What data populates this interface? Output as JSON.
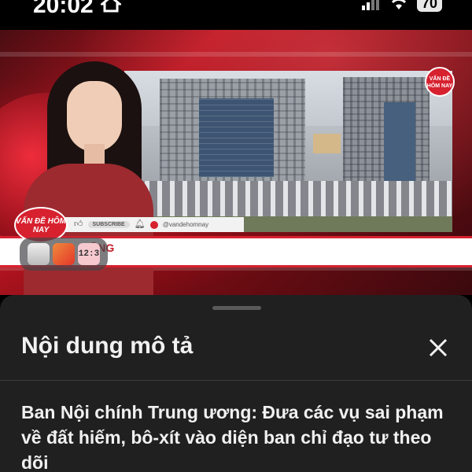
{
  "status_bar": {
    "time": "20:02",
    "battery": "70",
    "icons": [
      "home-icon",
      "cellular-signal-icon",
      "wifi-icon",
      "battery-icon"
    ]
  },
  "video": {
    "channel_logo": "VẤN ĐỀ HÔM NAY",
    "lower_third_logo": "VẤN ĐỀ HÔM NAY",
    "lower_third_text": "NẶNG",
    "social_bar": {
      "subscribe_label": "SUBSCRIBE",
      "handle": "@vandehomnay"
    },
    "mini_app_clock": "12:3",
    "colors": {
      "brand_red": "#d7212f"
    }
  },
  "description_sheet": {
    "title": "Nội dung mô tả",
    "headline": "Ban Nội chính Trung ương: Đưa các vụ sai phạm về đất hiếm, bô-xít vào diện ban chỉ đạo tư theo dõi",
    "close_icon": "close-icon"
  }
}
